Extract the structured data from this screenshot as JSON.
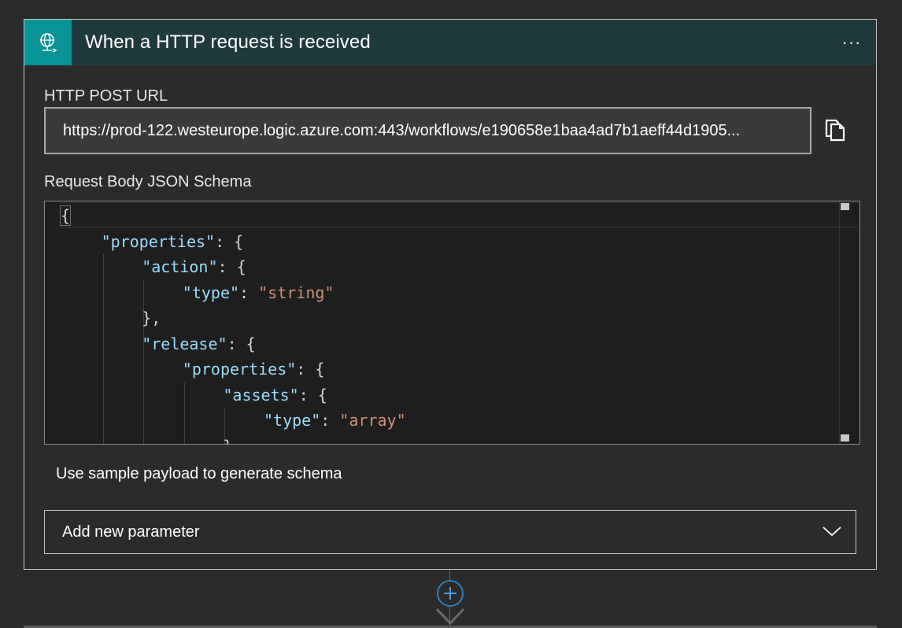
{
  "trigger": {
    "title": "When a HTTP request is received",
    "more_label": "···",
    "icon": "globe-request-icon",
    "accent_color": "#0a9396",
    "header_color": "#1f3a3d"
  },
  "url_field": {
    "label": "HTTP POST URL",
    "value": "https://prod-122.westeurope.logic.azure.com:443/workflows/e190658e1baa4ad7b1aeff44d1905...",
    "copy_icon": "copy-icon"
  },
  "schema": {
    "label": "Request Body JSON Schema",
    "lines": [
      {
        "indent": 0,
        "parts": [
          {
            "t": "{",
            "c": "punc",
            "match": true
          }
        ]
      },
      {
        "indent": 1,
        "parts": [
          {
            "t": "\"properties\"",
            "c": "key"
          },
          {
            "t": ": {",
            "c": "punc"
          }
        ]
      },
      {
        "indent": 2,
        "parts": [
          {
            "t": "\"action\"",
            "c": "key"
          },
          {
            "t": ": {",
            "c": "punc"
          }
        ]
      },
      {
        "indent": 3,
        "parts": [
          {
            "t": "\"type\"",
            "c": "key"
          },
          {
            "t": ": ",
            "c": "punc"
          },
          {
            "t": "\"string\"",
            "c": "str"
          }
        ]
      },
      {
        "indent": 2,
        "parts": [
          {
            "t": "},",
            "c": "punc"
          }
        ]
      },
      {
        "indent": 2,
        "parts": [
          {
            "t": "\"release\"",
            "c": "key"
          },
          {
            "t": ": {",
            "c": "punc"
          }
        ]
      },
      {
        "indent": 3,
        "parts": [
          {
            "t": "\"properties\"",
            "c": "key"
          },
          {
            "t": ": {",
            "c": "punc"
          }
        ]
      },
      {
        "indent": 4,
        "parts": [
          {
            "t": "\"assets\"",
            "c": "key"
          },
          {
            "t": ": {",
            "c": "punc"
          }
        ]
      },
      {
        "indent": 5,
        "parts": [
          {
            "t": "\"type\"",
            "c": "key"
          },
          {
            "t": ": ",
            "c": "punc"
          },
          {
            "t": "\"array\"",
            "c": "str"
          }
        ]
      },
      {
        "indent": 4,
        "parts": [
          {
            "t": "},",
            "c": "punc"
          }
        ]
      }
    ]
  },
  "sample_payload_link": "Use sample payload to generate schema",
  "parameter_select": {
    "label": "Add new parameter",
    "icon": "chevron-down-icon"
  },
  "add_step": {
    "icon": "plus-icon",
    "color": "#2f7fc1"
  }
}
